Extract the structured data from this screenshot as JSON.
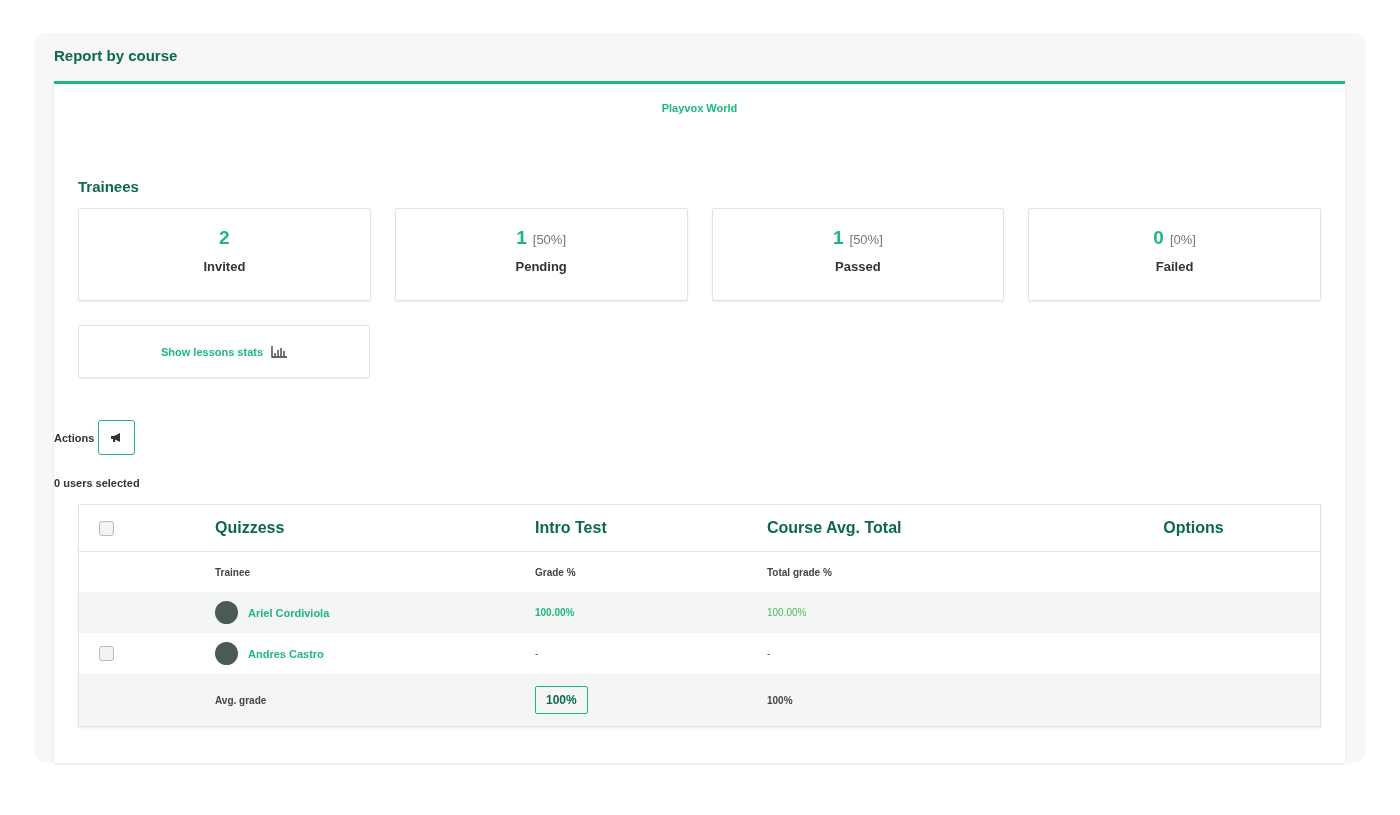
{
  "title": "Report by course",
  "course": "Playvox World",
  "section_title": "Trainees",
  "stats": [
    {
      "value": "2",
      "label": "Invited"
    },
    {
      "value": "1",
      "percent": "[50%]",
      "label": "Pending"
    },
    {
      "value": "1",
      "percent": "[50%]",
      "label": "Passed"
    },
    {
      "value": "0",
      "percent": "[0%]",
      "label": "Failed"
    }
  ],
  "lessons_button": "Show lessons stats",
  "actions_label": "Actions",
  "selected_count": "0 users selected",
  "table": {
    "select_all": {
      "checked": false
    },
    "columns": [
      "Quizzess",
      "Intro Test",
      "Course Avg. Total",
      "Options"
    ],
    "subheaders": [
      "Trainee",
      "Grade %",
      "Total grade %"
    ],
    "rows": [
      {
        "kind": "plain",
        "name": "Ariel Cordiviola",
        "grade": "100.00%",
        "total": "100.00%"
      },
      {
        "kind": "selectable",
        "checked": false,
        "name": "Andres Castro",
        "grade": "-",
        "total": "-"
      }
    ],
    "avg": {
      "label": "Avg. grade",
      "grade": "100%",
      "total": "100%"
    }
  }
}
